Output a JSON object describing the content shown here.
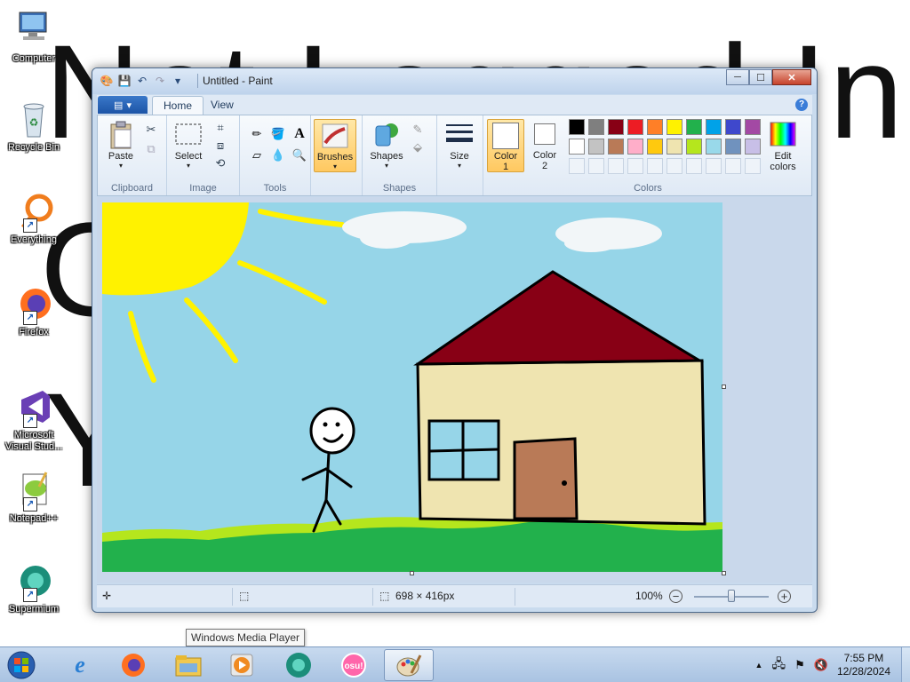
{
  "desktop": {
    "background_lines": [
      "Not Logged In",
      "G",
      "Y"
    ],
    "icons": [
      {
        "label": "Computer"
      },
      {
        "label": "Recycle Bin"
      },
      {
        "label": "Everything"
      },
      {
        "label": "Firefox"
      },
      {
        "label": "Microsoft Visual Stud..."
      },
      {
        "label": "Notepad++"
      },
      {
        "label": "Supermium"
      }
    ]
  },
  "window": {
    "title": "Untitled - Paint",
    "controls": {
      "minimize": "─",
      "maximize": "☐",
      "close": "✕"
    }
  },
  "ribbon": {
    "file_tab": "▤",
    "tabs": [
      "Home",
      "View"
    ],
    "active_tab": "Home",
    "help": "?",
    "groups": {
      "clipboard": {
        "label": "Clipboard",
        "paste": "Paste"
      },
      "image": {
        "label": "Image",
        "select": "Select"
      },
      "tools": {
        "label": "Tools"
      },
      "brushes": {
        "label": "Brushes"
      },
      "shapes": {
        "label": "Shapes",
        "button": "Shapes"
      },
      "size": {
        "label": "Size"
      },
      "colors": {
        "label": "Colors",
        "color1": "Color",
        "color1_num": "1",
        "color2": "Color",
        "color2_num": "2",
        "edit": "Edit",
        "edit2": "colors",
        "color1_value": "#ffffff",
        "color2_value": "#ffffff",
        "palette_row1": [
          "#000000",
          "#7f7f7f",
          "#880015",
          "#ed1c24",
          "#ff7f27",
          "#fff200",
          "#22b14c",
          "#00a2e8",
          "#3f48cc",
          "#a349a4"
        ],
        "palette_row2": [
          "#ffffff",
          "#c3c3c3",
          "#b97a57",
          "#ffaec9",
          "#ffc90e",
          "#efe4b0",
          "#b5e61d",
          "#99d9ea",
          "#7092be",
          "#c8bfe7"
        ]
      }
    }
  },
  "canvas": {
    "background": "#96d5e8"
  },
  "status": {
    "dimensions": "698 × 416px",
    "zoom": "100%",
    "zoom_out": "−",
    "zoom_in": "+"
  },
  "tooltip": "Windows Media Player",
  "taskbar": {
    "items": [
      "Internet Explorer",
      "Firefox",
      "File Explorer",
      "Windows Media Player",
      "Supermium",
      "osu!",
      "Paint"
    ],
    "osu_label": "osu!",
    "clock_time": "7:55 PM",
    "clock_date": "12/28/2024"
  }
}
